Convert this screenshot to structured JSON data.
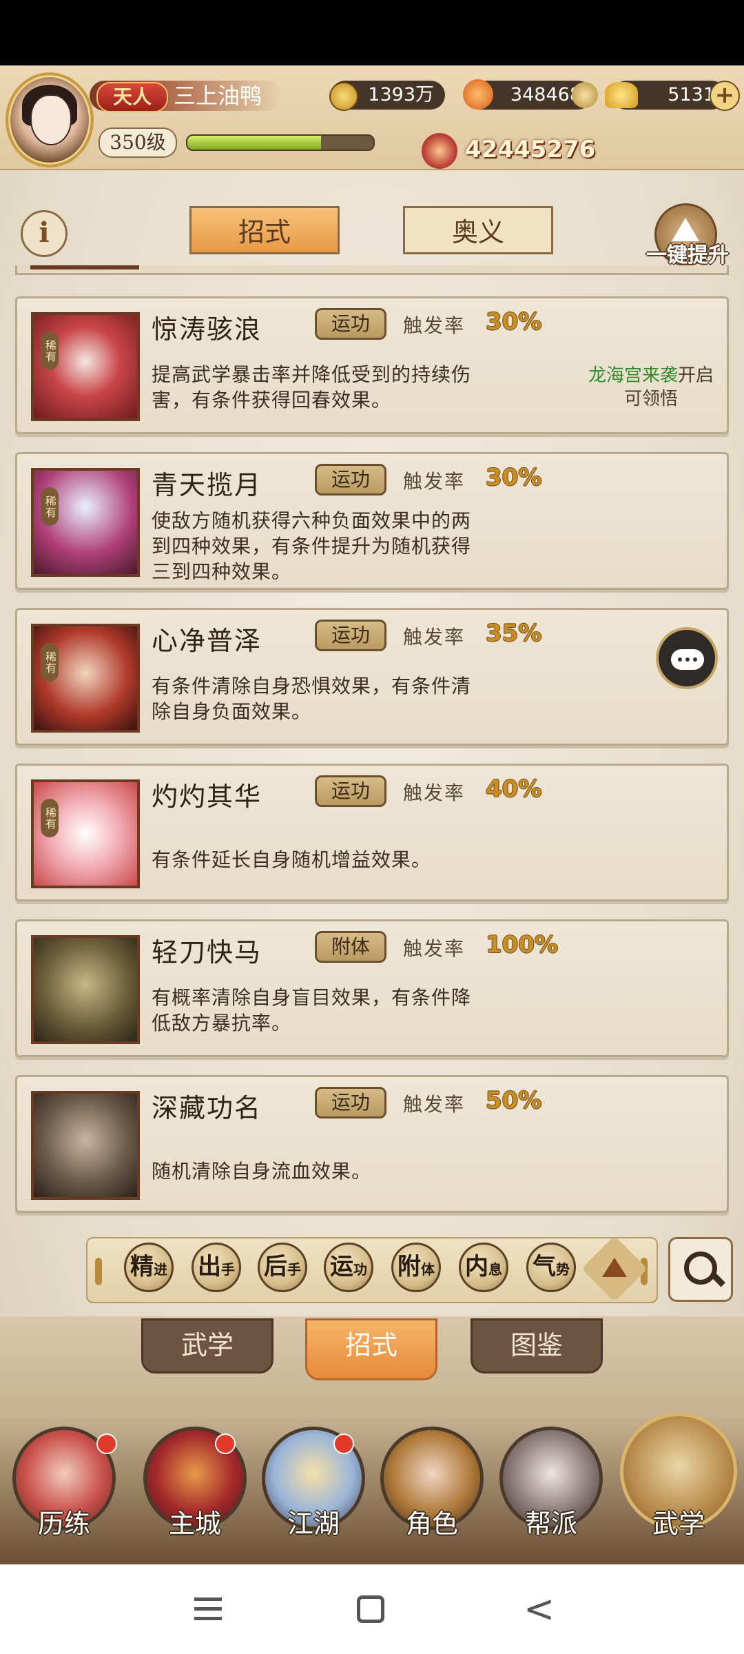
{
  "header": {
    "rank_badge": "天人",
    "player_name": "三上油鸭",
    "level": "350级",
    "xp_fraction": 0.72,
    "silver": "1393万",
    "ingots": "348468",
    "gold": "5131",
    "power": "42445276"
  },
  "tabs": {
    "moves": "招式",
    "secrets": "奥义",
    "one_key_upgrade": "一键提升"
  },
  "trigger_label": "触发率",
  "cards": [
    {
      "name": "惊涛骇浪",
      "badge": "稀有",
      "type": "运功",
      "rate": "30%",
      "desc_lines": [
        "提高武学暴击率并降低受到的持续伤",
        "害，有条件获得回春效果。"
      ],
      "unlock_source": "龙海宫来袭",
      "unlock_suffix": "开启",
      "unlock_line2": "可领悟"
    },
    {
      "name": "青天揽月",
      "badge": "稀有",
      "type": "运功",
      "rate": "30%",
      "desc_lines": [
        "使敌方随机获得六种负面效果中的两",
        "到四种效果，有条件提升为随机获得",
        "三到四种效果。"
      ]
    },
    {
      "name": "心净普泽",
      "badge": "稀有",
      "type": "运功",
      "rate": "35%",
      "desc_lines": [
        "有条件清除自身恐惧效果，有条件清",
        "除自身负面效果。"
      ]
    },
    {
      "name": "灼灼其华",
      "badge": "稀有",
      "type": "运功",
      "rate": "40%",
      "desc_lines": [
        "有条件延长自身随机增益效果。"
      ]
    },
    {
      "name": "轻刀快马",
      "type": "附体",
      "rate": "100%",
      "desc_lines": [
        "有概率清除自身盲目效果，有条件降",
        "低敌方暴抗率。"
      ]
    },
    {
      "name": "深藏功名",
      "type": "运功",
      "rate": "50%",
      "desc_lines": [
        "随机清除自身流血效果。"
      ]
    }
  ],
  "filters": [
    {
      "main": "精",
      "sub": "进"
    },
    {
      "main": "出",
      "sub": "手"
    },
    {
      "main": "后",
      "sub": "手"
    },
    {
      "main": "运",
      "sub": "功"
    },
    {
      "main": "附",
      "sub": "体"
    },
    {
      "main": "内",
      "sub": "息"
    },
    {
      "main": "气",
      "sub": "势"
    }
  ],
  "sub_tabs": {
    "martial": "武学",
    "moves": "招式",
    "catalog": "图鉴"
  },
  "bottom_nav": {
    "training": "历练",
    "city": "主城",
    "jianghu": "江湖",
    "character": "角色",
    "guild": "帮派",
    "martial": "武学"
  },
  "colors": {
    "accent_orange": "#e89a45",
    "rate_gold": "#c98e23",
    "unlock_green": "#2e8a2a"
  }
}
